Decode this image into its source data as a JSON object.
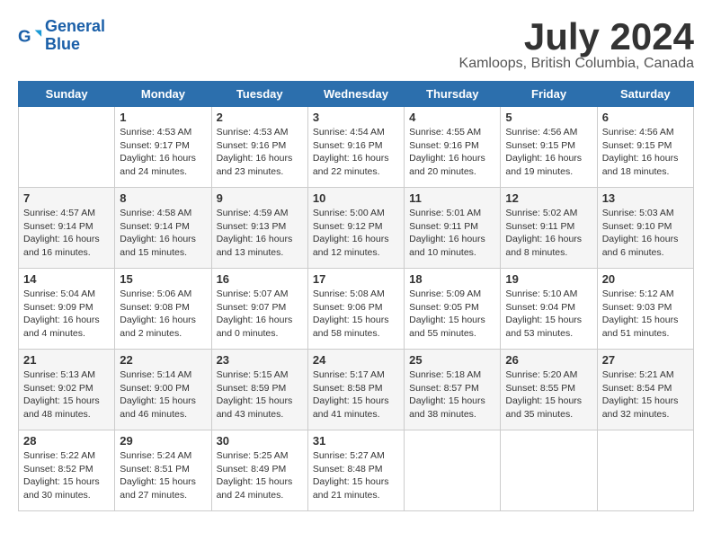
{
  "logo": {
    "line1": "General",
    "line2": "Blue"
  },
  "title": "July 2024",
  "subtitle": "Kamloops, British Columbia, Canada",
  "weekdays": [
    "Sunday",
    "Monday",
    "Tuesday",
    "Wednesday",
    "Thursday",
    "Friday",
    "Saturday"
  ],
  "weeks": [
    [
      {
        "day": "",
        "sunrise": "",
        "sunset": "",
        "daylight": ""
      },
      {
        "day": "1",
        "sunrise": "Sunrise: 4:53 AM",
        "sunset": "Sunset: 9:17 PM",
        "daylight": "Daylight: 16 hours and 24 minutes."
      },
      {
        "day": "2",
        "sunrise": "Sunrise: 4:53 AM",
        "sunset": "Sunset: 9:16 PM",
        "daylight": "Daylight: 16 hours and 23 minutes."
      },
      {
        "day": "3",
        "sunrise": "Sunrise: 4:54 AM",
        "sunset": "Sunset: 9:16 PM",
        "daylight": "Daylight: 16 hours and 22 minutes."
      },
      {
        "day": "4",
        "sunrise": "Sunrise: 4:55 AM",
        "sunset": "Sunset: 9:16 PM",
        "daylight": "Daylight: 16 hours and 20 minutes."
      },
      {
        "day": "5",
        "sunrise": "Sunrise: 4:56 AM",
        "sunset": "Sunset: 9:15 PM",
        "daylight": "Daylight: 16 hours and 19 minutes."
      },
      {
        "day": "6",
        "sunrise": "Sunrise: 4:56 AM",
        "sunset": "Sunset: 9:15 PM",
        "daylight": "Daylight: 16 hours and 18 minutes."
      }
    ],
    [
      {
        "day": "7",
        "sunrise": "Sunrise: 4:57 AM",
        "sunset": "Sunset: 9:14 PM",
        "daylight": "Daylight: 16 hours and 16 minutes."
      },
      {
        "day": "8",
        "sunrise": "Sunrise: 4:58 AM",
        "sunset": "Sunset: 9:14 PM",
        "daylight": "Daylight: 16 hours and 15 minutes."
      },
      {
        "day": "9",
        "sunrise": "Sunrise: 4:59 AM",
        "sunset": "Sunset: 9:13 PM",
        "daylight": "Daylight: 16 hours and 13 minutes."
      },
      {
        "day": "10",
        "sunrise": "Sunrise: 5:00 AM",
        "sunset": "Sunset: 9:12 PM",
        "daylight": "Daylight: 16 hours and 12 minutes."
      },
      {
        "day": "11",
        "sunrise": "Sunrise: 5:01 AM",
        "sunset": "Sunset: 9:11 PM",
        "daylight": "Daylight: 16 hours and 10 minutes."
      },
      {
        "day": "12",
        "sunrise": "Sunrise: 5:02 AM",
        "sunset": "Sunset: 9:11 PM",
        "daylight": "Daylight: 16 hours and 8 minutes."
      },
      {
        "day": "13",
        "sunrise": "Sunrise: 5:03 AM",
        "sunset": "Sunset: 9:10 PM",
        "daylight": "Daylight: 16 hours and 6 minutes."
      }
    ],
    [
      {
        "day": "14",
        "sunrise": "Sunrise: 5:04 AM",
        "sunset": "Sunset: 9:09 PM",
        "daylight": "Daylight: 16 hours and 4 minutes."
      },
      {
        "day": "15",
        "sunrise": "Sunrise: 5:06 AM",
        "sunset": "Sunset: 9:08 PM",
        "daylight": "Daylight: 16 hours and 2 minutes."
      },
      {
        "day": "16",
        "sunrise": "Sunrise: 5:07 AM",
        "sunset": "Sunset: 9:07 PM",
        "daylight": "Daylight: 16 hours and 0 minutes."
      },
      {
        "day": "17",
        "sunrise": "Sunrise: 5:08 AM",
        "sunset": "Sunset: 9:06 PM",
        "daylight": "Daylight: 15 hours and 58 minutes."
      },
      {
        "day": "18",
        "sunrise": "Sunrise: 5:09 AM",
        "sunset": "Sunset: 9:05 PM",
        "daylight": "Daylight: 15 hours and 55 minutes."
      },
      {
        "day": "19",
        "sunrise": "Sunrise: 5:10 AM",
        "sunset": "Sunset: 9:04 PM",
        "daylight": "Daylight: 15 hours and 53 minutes."
      },
      {
        "day": "20",
        "sunrise": "Sunrise: 5:12 AM",
        "sunset": "Sunset: 9:03 PM",
        "daylight": "Daylight: 15 hours and 51 minutes."
      }
    ],
    [
      {
        "day": "21",
        "sunrise": "Sunrise: 5:13 AM",
        "sunset": "Sunset: 9:02 PM",
        "daylight": "Daylight: 15 hours and 48 minutes."
      },
      {
        "day": "22",
        "sunrise": "Sunrise: 5:14 AM",
        "sunset": "Sunset: 9:00 PM",
        "daylight": "Daylight: 15 hours and 46 minutes."
      },
      {
        "day": "23",
        "sunrise": "Sunrise: 5:15 AM",
        "sunset": "Sunset: 8:59 PM",
        "daylight": "Daylight: 15 hours and 43 minutes."
      },
      {
        "day": "24",
        "sunrise": "Sunrise: 5:17 AM",
        "sunset": "Sunset: 8:58 PM",
        "daylight": "Daylight: 15 hours and 41 minutes."
      },
      {
        "day": "25",
        "sunrise": "Sunrise: 5:18 AM",
        "sunset": "Sunset: 8:57 PM",
        "daylight": "Daylight: 15 hours and 38 minutes."
      },
      {
        "day": "26",
        "sunrise": "Sunrise: 5:20 AM",
        "sunset": "Sunset: 8:55 PM",
        "daylight": "Daylight: 15 hours and 35 minutes."
      },
      {
        "day": "27",
        "sunrise": "Sunrise: 5:21 AM",
        "sunset": "Sunset: 8:54 PM",
        "daylight": "Daylight: 15 hours and 32 minutes."
      }
    ],
    [
      {
        "day": "28",
        "sunrise": "Sunrise: 5:22 AM",
        "sunset": "Sunset: 8:52 PM",
        "daylight": "Daylight: 15 hours and 30 minutes."
      },
      {
        "day": "29",
        "sunrise": "Sunrise: 5:24 AM",
        "sunset": "Sunset: 8:51 PM",
        "daylight": "Daylight: 15 hours and 27 minutes."
      },
      {
        "day": "30",
        "sunrise": "Sunrise: 5:25 AM",
        "sunset": "Sunset: 8:49 PM",
        "daylight": "Daylight: 15 hours and 24 minutes."
      },
      {
        "day": "31",
        "sunrise": "Sunrise: 5:27 AM",
        "sunset": "Sunset: 8:48 PM",
        "daylight": "Daylight: 15 hours and 21 minutes."
      },
      {
        "day": "",
        "sunrise": "",
        "sunset": "",
        "daylight": ""
      },
      {
        "day": "",
        "sunrise": "",
        "sunset": "",
        "daylight": ""
      },
      {
        "day": "",
        "sunrise": "",
        "sunset": "",
        "daylight": ""
      }
    ]
  ]
}
